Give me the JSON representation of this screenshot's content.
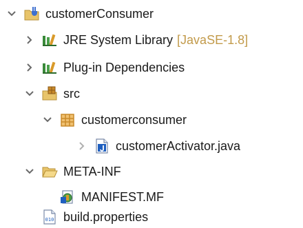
{
  "tree": {
    "project": {
      "label": "customerConsumer",
      "icon": "plugin-project-icon",
      "expanded": true
    },
    "jre": {
      "label": "JRE System Library",
      "decoration": "[JavaSE-1.8]",
      "icon": "library-icon",
      "expanded": false
    },
    "plugin_deps": {
      "label": "Plug-in Dependencies",
      "icon": "library-icon",
      "expanded": false
    },
    "src": {
      "label": "src",
      "icon": "source-folder-icon",
      "expanded": true
    },
    "package": {
      "label": "customerconsumer",
      "icon": "package-icon",
      "expanded": true
    },
    "java_file": {
      "label": "customerActivator.java",
      "icon": "java-file-icon",
      "expanded": false
    },
    "meta_inf": {
      "label": "META-INF",
      "icon": "folder-icon",
      "expanded": true
    },
    "manifest": {
      "label": "MANIFEST.MF",
      "icon": "manifest-icon"
    },
    "build_properties": {
      "label": "build.properties",
      "icon": "properties-file-icon"
    }
  },
  "colors": {
    "twisty": "#6a6a6a",
    "decoration": "#c29a4a",
    "folder": "#e8c46a",
    "library_green": "#3a8a3a",
    "java_blue": "#1f5fbf",
    "package_orange": "#c98a2a"
  }
}
